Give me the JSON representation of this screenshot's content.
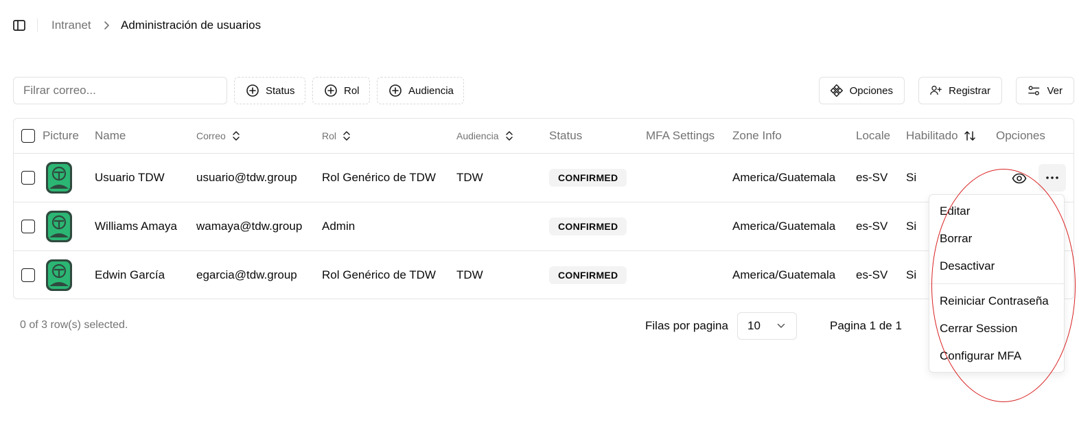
{
  "breadcrumb": {
    "root": "Intranet",
    "current": "Administración de usuarios"
  },
  "toolbar": {
    "filter_placeholder": "Filrar correo...",
    "chips": {
      "status": "Status",
      "rol": "Rol",
      "audiencia": "Audiencia"
    },
    "buttons": {
      "opciones": "Opciones",
      "registrar": "Registrar",
      "ver": "Ver"
    }
  },
  "table": {
    "headers": {
      "picture": "Picture",
      "name": "Name",
      "correo": "Correo",
      "rol": "Rol",
      "audiencia": "Audiencia",
      "status": "Status",
      "mfa": "MFA Settings",
      "zone": "Zone Info",
      "locale": "Locale",
      "habilitado": "Habilitado",
      "opciones": "Opciones"
    },
    "rows": [
      {
        "name": "Usuario TDW",
        "correo": "usuario@tdw.group",
        "rol": "Rol Genérico de TDW",
        "audiencia": "TDW",
        "status": "CONFIRMED",
        "zone": "America/Guatemala",
        "locale": "es-SV",
        "habilitado": "Si"
      },
      {
        "name": "Williams Amaya",
        "correo": "wamaya@tdw.group",
        "rol": "Admin",
        "audiencia": "",
        "status": "CONFIRMED",
        "zone": "America/Guatemala",
        "locale": "es-SV",
        "habilitado": "Si"
      },
      {
        "name": "Edwin García",
        "correo": "egarcia@tdw.group",
        "rol": "Rol Genérico de TDW",
        "audiencia": "TDW",
        "status": "CONFIRMED",
        "zone": "America/Guatemala",
        "locale": "es-SV",
        "habilitado": "Si"
      }
    ]
  },
  "footer": {
    "selected": "0 of 3 row(s) selected.",
    "rows_per_page_label": "Filas por pagina",
    "rows_per_page_value": "10",
    "page_info": "Pagina 1 de 1"
  },
  "row_menu": {
    "items": [
      "Editar",
      "Borrar",
      "Desactivar",
      "Reiniciar Contraseña",
      "Cerrar Session",
      "Configurar MFA"
    ]
  },
  "colors": {
    "avatar_green": "#2bb673",
    "avatar_dark": "#2f4a3f",
    "annotation": "#d92020",
    "muted": "#737373"
  },
  "icons": [
    "sidebar-toggle-icon",
    "chevron-right-icon",
    "plus-circle-icon",
    "options-icon",
    "user-plus-icon",
    "sliders-icon",
    "sort-icon",
    "eye-icon",
    "ellipsis-icon",
    "chevron-down-icon"
  ]
}
